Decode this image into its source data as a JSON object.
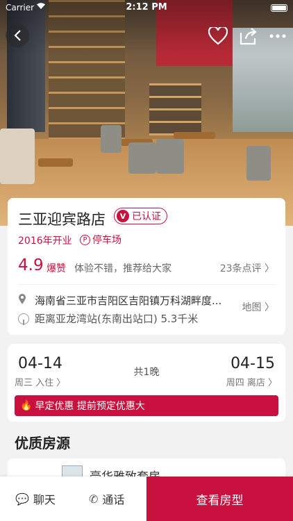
{
  "status_bar": {
    "carrier": "Carrier",
    "time": "2:12 PM"
  },
  "nav": {
    "back_icon": "back-icon",
    "favorite_icon": "heart-icon",
    "share_icon": "share-icon",
    "more_icon": "more-icon"
  },
  "hotel": {
    "name": "三亚迎宾路店",
    "verified_badge": "已认证",
    "verified_mark": "V",
    "opened": "2016年开业",
    "parking_mark": "P",
    "parking": "停车场",
    "score": "4.9",
    "score_label": "爆赞",
    "review_quote": "体验不错，推荐给大家",
    "review_count": "23条点评 〉",
    "address": "海南省三亚市吉阳区吉阳镇万科湖畔度...",
    "distance": "距离亚龙湾站(东南出站口) 5.3千米",
    "map_link": "地图 〉"
  },
  "stay": {
    "checkin_date": "04-14",
    "checkin_label": "周三 入住 〉",
    "nights": "共1晚",
    "checkout_date": "04-15",
    "checkout_label": "周四 离店 〉",
    "promo_icon": "🔥",
    "promo": "早定优惠 提前预定优惠大"
  },
  "rooms": {
    "section_title": "优质房源",
    "first_room_name": "豪华雅致套房"
  },
  "bottom": {
    "chat_icon": "💬",
    "chat": "聊天",
    "call_icon": "✆",
    "call": "通话",
    "view_rooms": "查看房型"
  },
  "colors": {
    "accent": "#c8113f"
  }
}
